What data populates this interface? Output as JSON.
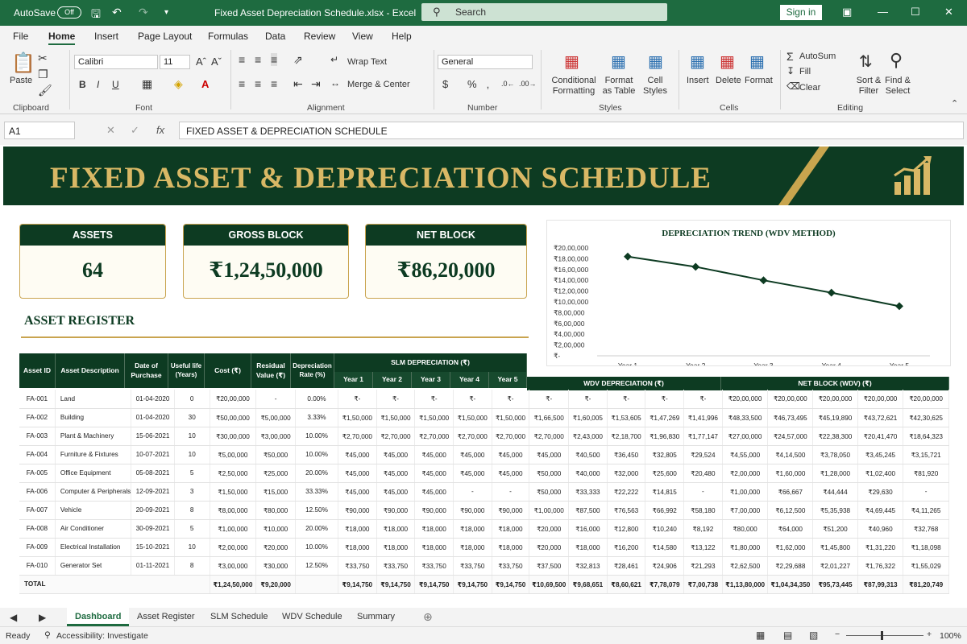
{
  "titlebar": {
    "autosave": "AutoSave",
    "autosave_state": "Off",
    "doc_title": "Fixed Asset Depreciation Schedule.xlsx  -  Excel",
    "search_placeholder": "Search",
    "signin": "Sign in"
  },
  "menu": [
    "File",
    "Home",
    "Insert",
    "Page Layout",
    "Formulas",
    "Data",
    "Review",
    "View",
    "Help"
  ],
  "ribbon": {
    "paste": "Paste",
    "font_name": "Calibri",
    "font_size": "11",
    "wrap_text": "Wrap Text",
    "merge_center": "Merge & Center",
    "number_format": "General",
    "conditional_formatting": "Conditional Formatting",
    "format_as_table": "Format as Table",
    "cell_styles": "Cell Styles",
    "insert": "Insert",
    "delete": "Delete",
    "format": "Format",
    "autosum": "AutoSum",
    "fill": "Fill",
    "clear": "Clear",
    "sort_filter": "Sort & Filter",
    "find_select": "Find & Select",
    "groups": [
      "Clipboard",
      "Font",
      "Alignment",
      "Number",
      "Styles",
      "Cells",
      "Editing"
    ]
  },
  "formula_bar": {
    "name_box": "A1",
    "fx": "fx",
    "content": "FIXED ASSET & DEPRECIATION SCHEDULE"
  },
  "dashboard": {
    "title": "FIXED ASSET & DEPRECIATION SCHEDULE",
    "kpis": [
      {
        "label": "ASSETS",
        "value": "64"
      },
      {
        "label": "GROSS BLOCK",
        "value": "₹1,24,50,000"
      },
      {
        "label": "NET BLOCK",
        "value": "₹86,20,000"
      }
    ],
    "register_title": "ASSET REGISTER"
  },
  "chart_data": {
    "type": "line",
    "title": "DEPRECIATION TREND (WDV METHOD)",
    "categories": [
      "Year 1",
      "Year 2",
      "Year 3",
      "Year 4",
      "Year 5"
    ],
    "series": [
      {
        "values": [
          1840000,
          1650000,
          1400000,
          1170000,
          920000
        ]
      }
    ],
    "ylim": [
      0,
      2000000
    ],
    "yticks": [
      "₹20,00,000",
      "₹18,00,000",
      "₹16,00,000",
      "₹14,00,000",
      "₹12,00,000",
      "₹10,00,000",
      "₹8,00,000",
      "₹6,00,000",
      "₹4,00,000",
      "₹2,00,000",
      "₹-"
    ],
    "grid": false,
    "color": "#0d3b22"
  },
  "table": {
    "headers": {
      "asset_id": "Asset ID",
      "description": "Asset Description",
      "date": "Date of Purchase",
      "useful_life": "Useful life (Years)",
      "cost": "Cost (₹)",
      "residual": "Residual Value (₹)",
      "rate": "Depreciation Rate (%)",
      "slm": "SLM DEPRECIATION (₹)",
      "wdv": "WDV DEPRECIATION (₹)",
      "net": "NET BLOCK (WDV) (₹)",
      "years": [
        "Year 1",
        "Year 2",
        "Year 3",
        "Year 4",
        "Year 5"
      ]
    },
    "rows": [
      {
        "id": "FA-001",
        "desc": "Land",
        "date": "01-04-2020",
        "life": "0",
        "cost": "₹20,00,000",
        "res": "-",
        "rate": "0.00%",
        "slm": [
          "₹-",
          "₹-",
          "₹-",
          "₹-",
          "₹-"
        ],
        "wdv": [
          "₹-",
          "₹-",
          "₹-",
          "₹-",
          "₹-"
        ],
        "net": [
          "₹20,00,000",
          "₹20,00,000",
          "₹20,00,000",
          "₹20,00,000",
          "₹20,00,000"
        ]
      },
      {
        "id": "FA-002",
        "desc": "Building",
        "date": "01-04-2020",
        "life": "30",
        "cost": "₹50,00,000",
        "res": "₹5,00,000",
        "rate": "3.33%",
        "slm": [
          "₹1,50,000",
          "₹1,50,000",
          "₹1,50,000",
          "₹1,50,000",
          "₹1,50,000"
        ],
        "wdv": [
          "₹1,66,500",
          "₹1,60,005",
          "₹1,53,605",
          "₹1,47,269",
          "₹1,41,996"
        ],
        "net": [
          "₹48,33,500",
          "₹46,73,495",
          "₹45,19,890",
          "₹43,72,621",
          "₹42,30,625"
        ]
      },
      {
        "id": "FA-003",
        "desc": "Plant & Machinery",
        "date": "15-06-2021",
        "life": "10",
        "cost": "₹30,00,000",
        "res": "₹3,00,000",
        "rate": "10.00%",
        "slm": [
          "₹2,70,000",
          "₹2,70,000",
          "₹2,70,000",
          "₹2,70,000",
          "₹2,70,000"
        ],
        "wdv": [
          "₹2,70,000",
          "₹2,43,000",
          "₹2,18,700",
          "₹1,96,830",
          "₹1,77,147"
        ],
        "net": [
          "₹27,00,000",
          "₹24,57,000",
          "₹22,38,300",
          "₹20,41,470",
          "₹18,64,323"
        ]
      },
      {
        "id": "FA-004",
        "desc": "Furniture & Fixtures",
        "date": "10-07-2021",
        "life": "10",
        "cost": "₹5,00,000",
        "res": "₹50,000",
        "rate": "10.00%",
        "slm": [
          "₹45,000",
          "₹45,000",
          "₹45,000",
          "₹45,000",
          "₹45,000"
        ],
        "wdv": [
          "₹45,000",
          "₹40,500",
          "₹36,450",
          "₹32,805",
          "₹29,524"
        ],
        "net": [
          "₹4,55,000",
          "₹4,14,500",
          "₹3,78,050",
          "₹3,45,245",
          "₹3,15,721"
        ]
      },
      {
        "id": "FA-005",
        "desc": "Office Equipment",
        "date": "05-08-2021",
        "life": "5",
        "cost": "₹2,50,000",
        "res": "₹25,000",
        "rate": "20.00%",
        "slm": [
          "₹45,000",
          "₹45,000",
          "₹45,000",
          "₹45,000",
          "₹45,000"
        ],
        "wdv": [
          "₹50,000",
          "₹40,000",
          "₹32,000",
          "₹25,600",
          "₹20,480"
        ],
        "net": [
          "₹2,00,000",
          "₹1,60,000",
          "₹1,28,000",
          "₹1,02,400",
          "₹81,920"
        ]
      },
      {
        "id": "FA-006",
        "desc": "Computer & Peripherals",
        "date": "12-09-2021",
        "life": "3",
        "cost": "₹1,50,000",
        "res": "₹15,000",
        "rate": "33.33%",
        "slm": [
          "₹45,000",
          "₹45,000",
          "₹45,000",
          "-",
          "-"
        ],
        "wdv": [
          "₹50,000",
          "₹33,333",
          "₹22,222",
          "₹14,815",
          "-"
        ],
        "net": [
          "₹1,00,000",
          "₹66,667",
          "₹44,444",
          "₹29,630",
          "-"
        ]
      },
      {
        "id": "FA-007",
        "desc": "Vehicle",
        "date": "20-09-2021",
        "life": "8",
        "cost": "₹8,00,000",
        "res": "₹80,000",
        "rate": "12.50%",
        "slm": [
          "₹90,000",
          "₹90,000",
          "₹90,000",
          "₹90,000",
          "₹90,000"
        ],
        "wdv": [
          "₹1,00,000",
          "₹87,500",
          "₹76,563",
          "₹66,992",
          "₹58,180"
        ],
        "net": [
          "₹7,00,000",
          "₹6,12,500",
          "₹5,35,938",
          "₹4,69,445",
          "₹4,11,265"
        ]
      },
      {
        "id": "FA-008",
        "desc": "Air Conditioner",
        "date": "30-09-2021",
        "life": "5",
        "cost": "₹1,00,000",
        "res": "₹10,000",
        "rate": "20.00%",
        "slm": [
          "₹18,000",
          "₹18,000",
          "₹18,000",
          "₹18,000",
          "₹18,000"
        ],
        "wdv": [
          "₹20,000",
          "₹16,000",
          "₹12,800",
          "₹10,240",
          "₹8,192"
        ],
        "net": [
          "₹80,000",
          "₹64,000",
          "₹51,200",
          "₹40,960",
          "₹32,768"
        ]
      },
      {
        "id": "FA-009",
        "desc": "Electrical Installation",
        "date": "15-10-2021",
        "life": "10",
        "cost": "₹2,00,000",
        "res": "₹20,000",
        "rate": "10.00%",
        "slm": [
          "₹18,000",
          "₹18,000",
          "₹18,000",
          "₹18,000",
          "₹18,000"
        ],
        "wdv": [
          "₹20,000",
          "₹18,000",
          "₹16,200",
          "₹14,580",
          "₹13,122"
        ],
        "net": [
          "₹1,80,000",
          "₹1,62,000",
          "₹1,45,800",
          "₹1,31,220",
          "₹1,18,098"
        ]
      },
      {
        "id": "FA-010",
        "desc": "Generator Set",
        "date": "01-11-2021",
        "life": "8",
        "cost": "₹3,00,000",
        "res": "₹30,000",
        "rate": "12.50%",
        "slm": [
          "₹33,750",
          "₹33,750",
          "₹33,750",
          "₹33,750",
          "₹33,750"
        ],
        "wdv": [
          "₹37,500",
          "₹32,813",
          "₹28,461",
          "₹24,906",
          "₹21,293"
        ],
        "net": [
          "₹2,62,500",
          "₹2,29,688",
          "₹2,01,227",
          "₹1,76,322",
          "₹1,55,029"
        ]
      }
    ],
    "total": {
      "label": "TOTAL",
      "cost": "₹1,24,50,000",
      "res": "₹9,20,000",
      "slm": [
        "₹9,14,750",
        "₹9,14,750",
        "₹9,14,750",
        "₹9,14,750",
        "₹9,14,750"
      ],
      "wdv": [
        "₹10,69,500",
        "₹9,68,651",
        "₹8,60,621",
        "₹7,78,079",
        "₹7,00,738"
      ],
      "net": [
        "₹1,13,80,000",
        "₹1,04,34,350",
        "₹95,73,445",
        "₹87,99,313",
        "₹81,20,749"
      ]
    }
  },
  "sheets": [
    "Dashboard",
    "Asset Register",
    "SLM Schedule",
    "WDV Schedule",
    "Summary"
  ],
  "status": {
    "ready": "Ready",
    "accessibility": "Accessibility: Investigate",
    "zoom": "100%"
  }
}
